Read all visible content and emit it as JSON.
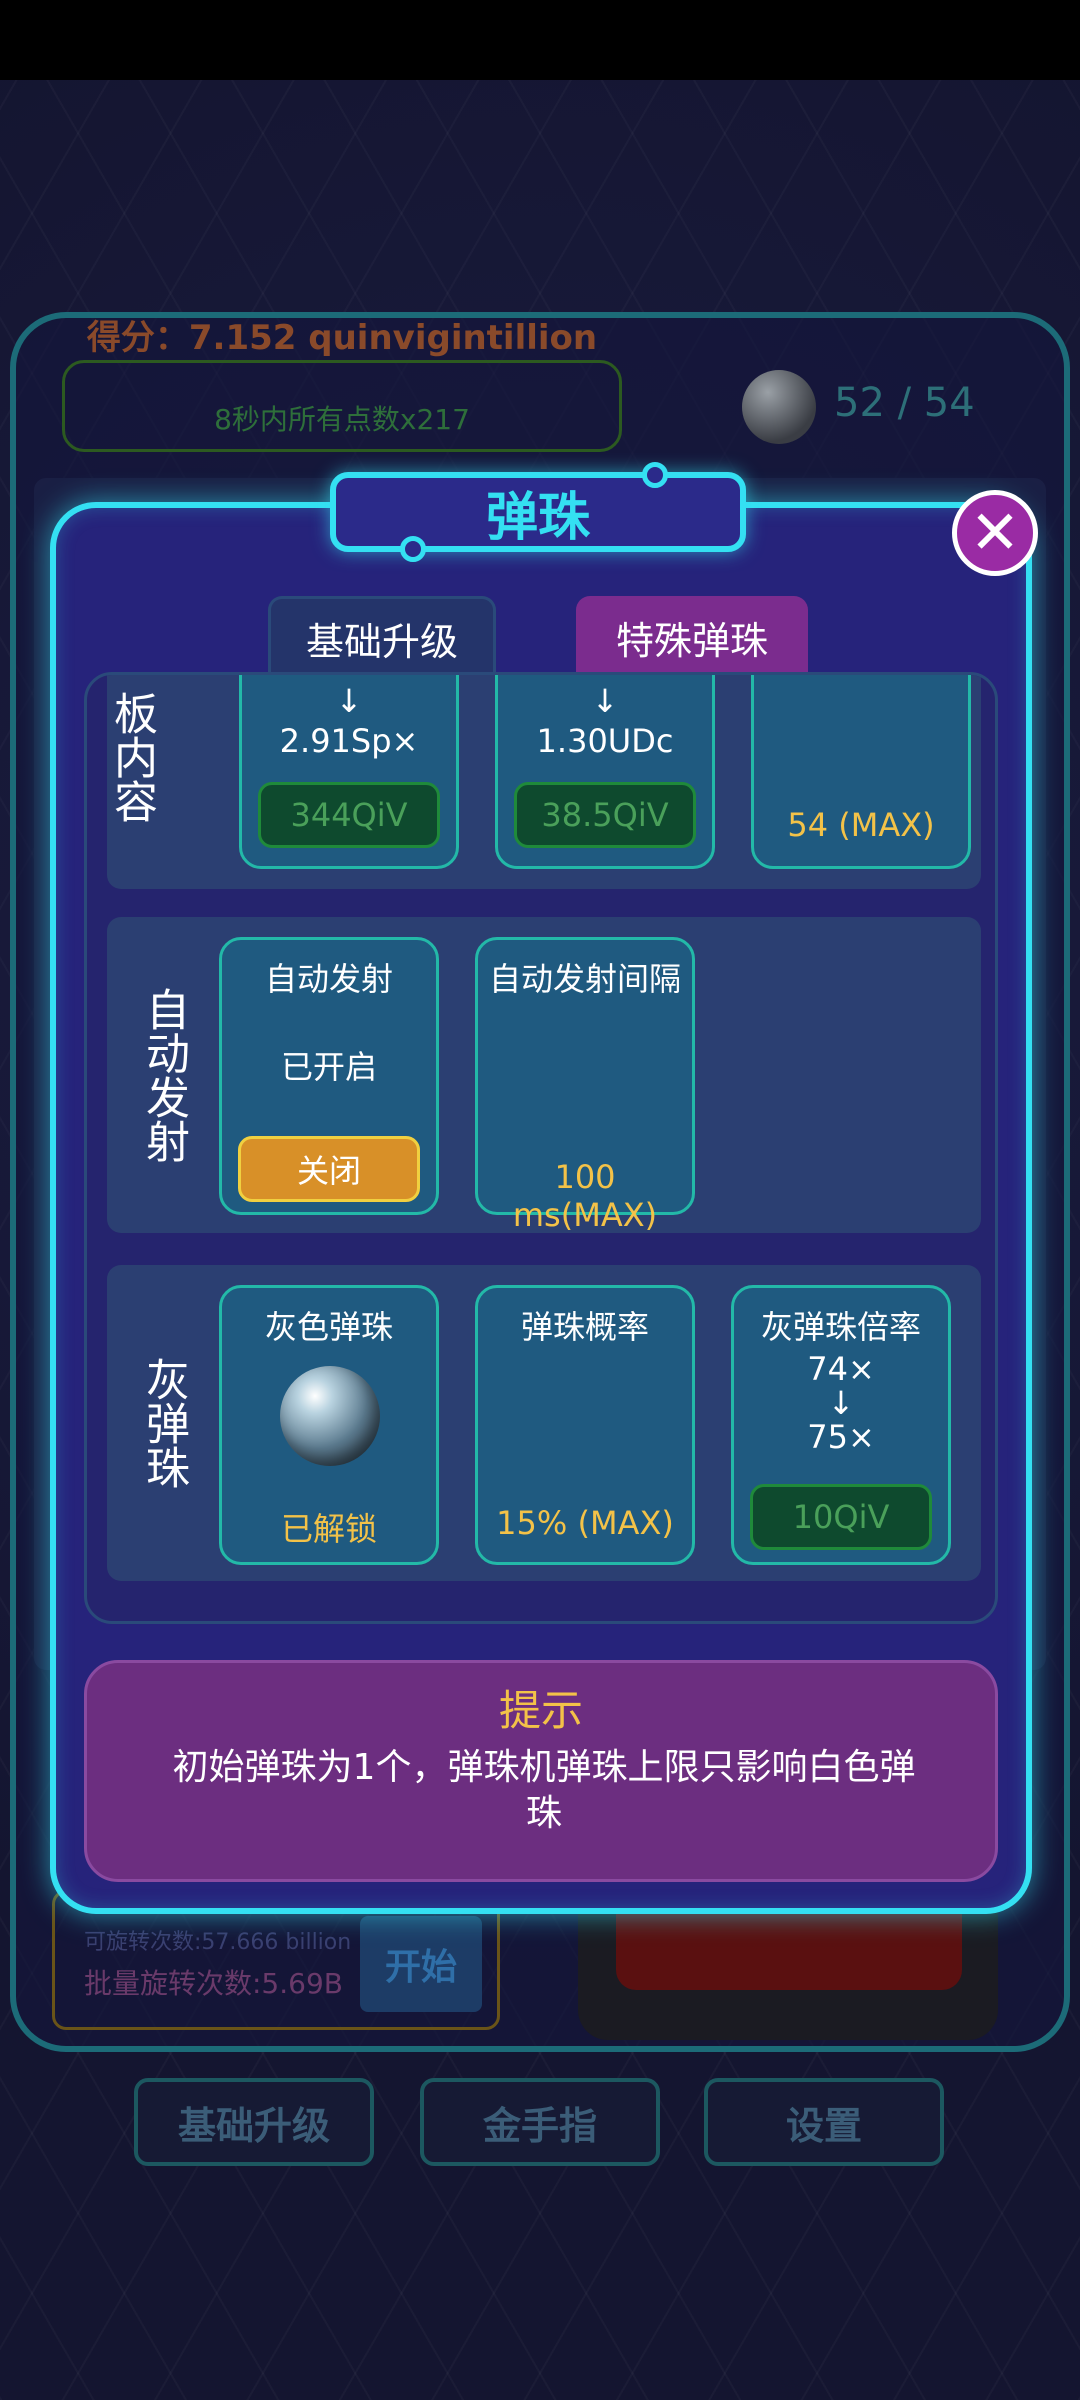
{
  "background": {
    "score_title": "得分：7.152 quinvigintillion",
    "score_sub": "8秒内所有点数x217",
    "ball_count": "52 / 54",
    "spins_available": "可旋转次数:57.666 billion",
    "batch_spins": "批量旋转次数:5.69B",
    "start_label": "开始",
    "bottom_buttons": [
      "基础升级",
      "金手指",
      "设置"
    ]
  },
  "modal": {
    "title": "弹珠",
    "close_icon": "close-icon",
    "tabs": [
      "基础升级",
      "特殊弹珠"
    ],
    "sections": [
      {
        "label": "板内容",
        "cards": [
          {
            "arrow": "↓",
            "value": "2.91Sp×",
            "price": "344QiV"
          },
          {
            "arrow": "↓",
            "value": "1.30UDc",
            "price": "38.5QiV"
          },
          {
            "footer": "54 (MAX)"
          }
        ]
      },
      {
        "label": "自动发射",
        "cards": [
          {
            "title": "自动发射",
            "status": "已开启",
            "button": "关闭"
          },
          {
            "title": "自动发射间隔",
            "footer": "100 ms(MAX)"
          }
        ]
      },
      {
        "label": "灰弹珠",
        "cards": [
          {
            "title": "灰色弹珠",
            "icon": "gray-marble-icon",
            "footer": "已解锁"
          },
          {
            "title": "弹珠概率",
            "footer": "15% (MAX)"
          },
          {
            "title": "灰弹珠倍率",
            "from": "74×",
            "arrow": "↓",
            "to": "75×",
            "price": "10QiV"
          }
        ]
      }
    ],
    "tip": {
      "title": "提示",
      "text": "初始弹珠为1个，弹珠机弹珠上限只影响白色弹珠"
    }
  }
}
